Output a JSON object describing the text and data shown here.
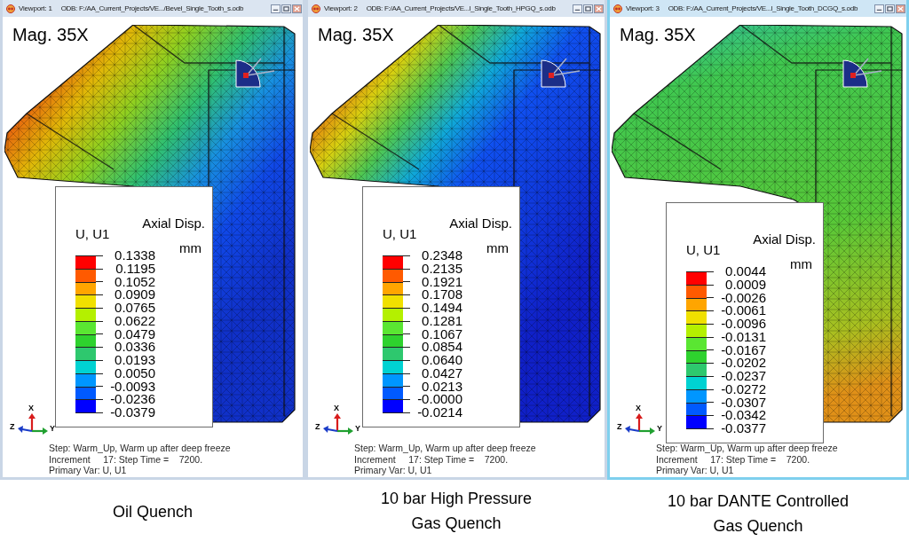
{
  "viewports": [
    {
      "viewport_label": "Viewport: 1",
      "odb_path": "ODB: F:/AA_Current_Projects/VE.../Bevel_Single_Tooth_s.odb",
      "active": false,
      "magnification": "Mag. 35X",
      "legend": {
        "variable": "U, U1",
        "quantity": "Axial Disp.",
        "unit": "mm",
        "values": [
          "0.1338",
          "0.1195",
          "0.1052",
          "0.0909",
          "0.0765",
          "0.0622",
          "0.0479",
          "0.0336",
          "0.0193",
          "0.0050",
          "-0.0093",
          "-0.0236",
          "-0.0379"
        ],
        "bands": [
          {
            "color": "#ff0000"
          },
          {
            "color": "#ff5a00"
          },
          {
            "color": "#ffa500"
          },
          {
            "color": "#f0e000"
          },
          {
            "color": "#b4f000"
          },
          {
            "color": "#5ae632"
          },
          {
            "color": "#2ed22e"
          },
          {
            "color": "#2ec86e"
          },
          {
            "color": "#00d2d2"
          },
          {
            "color": "#0096ff"
          },
          {
            "color": "#005aff"
          },
          {
            "color": "#0000ff"
          }
        ]
      },
      "triad": {
        "x": "X",
        "y": "Y",
        "z": "Z"
      },
      "status": [
        "Step: Warm_Up, Warm up after deep freeze",
        "Increment     17: Step Time =    7200.",
        "Primary Var: U, U1"
      ],
      "caption": "Oil Quench"
    },
    {
      "viewport_label": "Viewport: 2",
      "odb_path": "ODB: F:/AA_Current_Projects/VE...l_Single_Tooth_HPGQ_s.odb",
      "active": false,
      "magnification": "Mag. 35X",
      "legend": {
        "variable": "U, U1",
        "quantity": "Axial Disp.",
        "unit": "mm",
        "values": [
          "0.2348",
          "0.2135",
          "0.1921",
          "0.1708",
          "0.1494",
          "0.1281",
          "0.1067",
          "0.0854",
          "0.0640",
          "0.0427",
          "0.0213",
          "-0.0000",
          "-0.0214"
        ],
        "bands": [
          {
            "color": "#ff0000"
          },
          {
            "color": "#ff5a00"
          },
          {
            "color": "#ffa500"
          },
          {
            "color": "#f0e000"
          },
          {
            "color": "#b4f000"
          },
          {
            "color": "#5ae632"
          },
          {
            "color": "#2ed22e"
          },
          {
            "color": "#2ec86e"
          },
          {
            "color": "#00d2d2"
          },
          {
            "color": "#0096ff"
          },
          {
            "color": "#005aff"
          },
          {
            "color": "#0000ff"
          }
        ]
      },
      "triad": {
        "x": "X",
        "y": "Y",
        "z": "Z"
      },
      "status": [
        "Step: Warm_Up, Warm up after deep freeze",
        "Increment     17: Step Time =    7200.",
        "Primary Var: U, U1"
      ],
      "caption": "10 bar High Pressure\nGas Quench"
    },
    {
      "viewport_label": "Viewport: 3",
      "odb_path": "ODB: F:/AA_Current_Projects/VE...l_Single_Tooth_DCGQ_s.odb",
      "active": true,
      "magnification": "Mag. 35X",
      "legend": {
        "variable": "U, U1",
        "quantity": "Axial Disp.",
        "unit": "mm",
        "values": [
          "0.0044",
          "0.0009",
          "-0.0026",
          "-0.0061",
          "-0.0096",
          "-0.0131",
          "-0.0167",
          "-0.0202",
          "-0.0237",
          "-0.0272",
          "-0.0307",
          "-0.0342",
          "-0.0377"
        ],
        "bands": [
          {
            "color": "#ff0000"
          },
          {
            "color": "#ff5a00"
          },
          {
            "color": "#ffa500"
          },
          {
            "color": "#f0e000"
          },
          {
            "color": "#b4f000"
          },
          {
            "color": "#5ae632"
          },
          {
            "color": "#2ed22e"
          },
          {
            "color": "#2ec86e"
          },
          {
            "color": "#00d2d2"
          },
          {
            "color": "#0096ff"
          },
          {
            "color": "#005aff"
          },
          {
            "color": "#0000ff"
          }
        ]
      },
      "triad": {
        "x": "X",
        "y": "Y",
        "z": "Z"
      },
      "status": [
        "Step: Warm_Up, Warm up after deep freeze",
        "Increment     17: Step Time =    7200.",
        "Primary Var: U, U1"
      ],
      "caption": "10 bar DANTE Controlled\nGas Quench"
    }
  ]
}
